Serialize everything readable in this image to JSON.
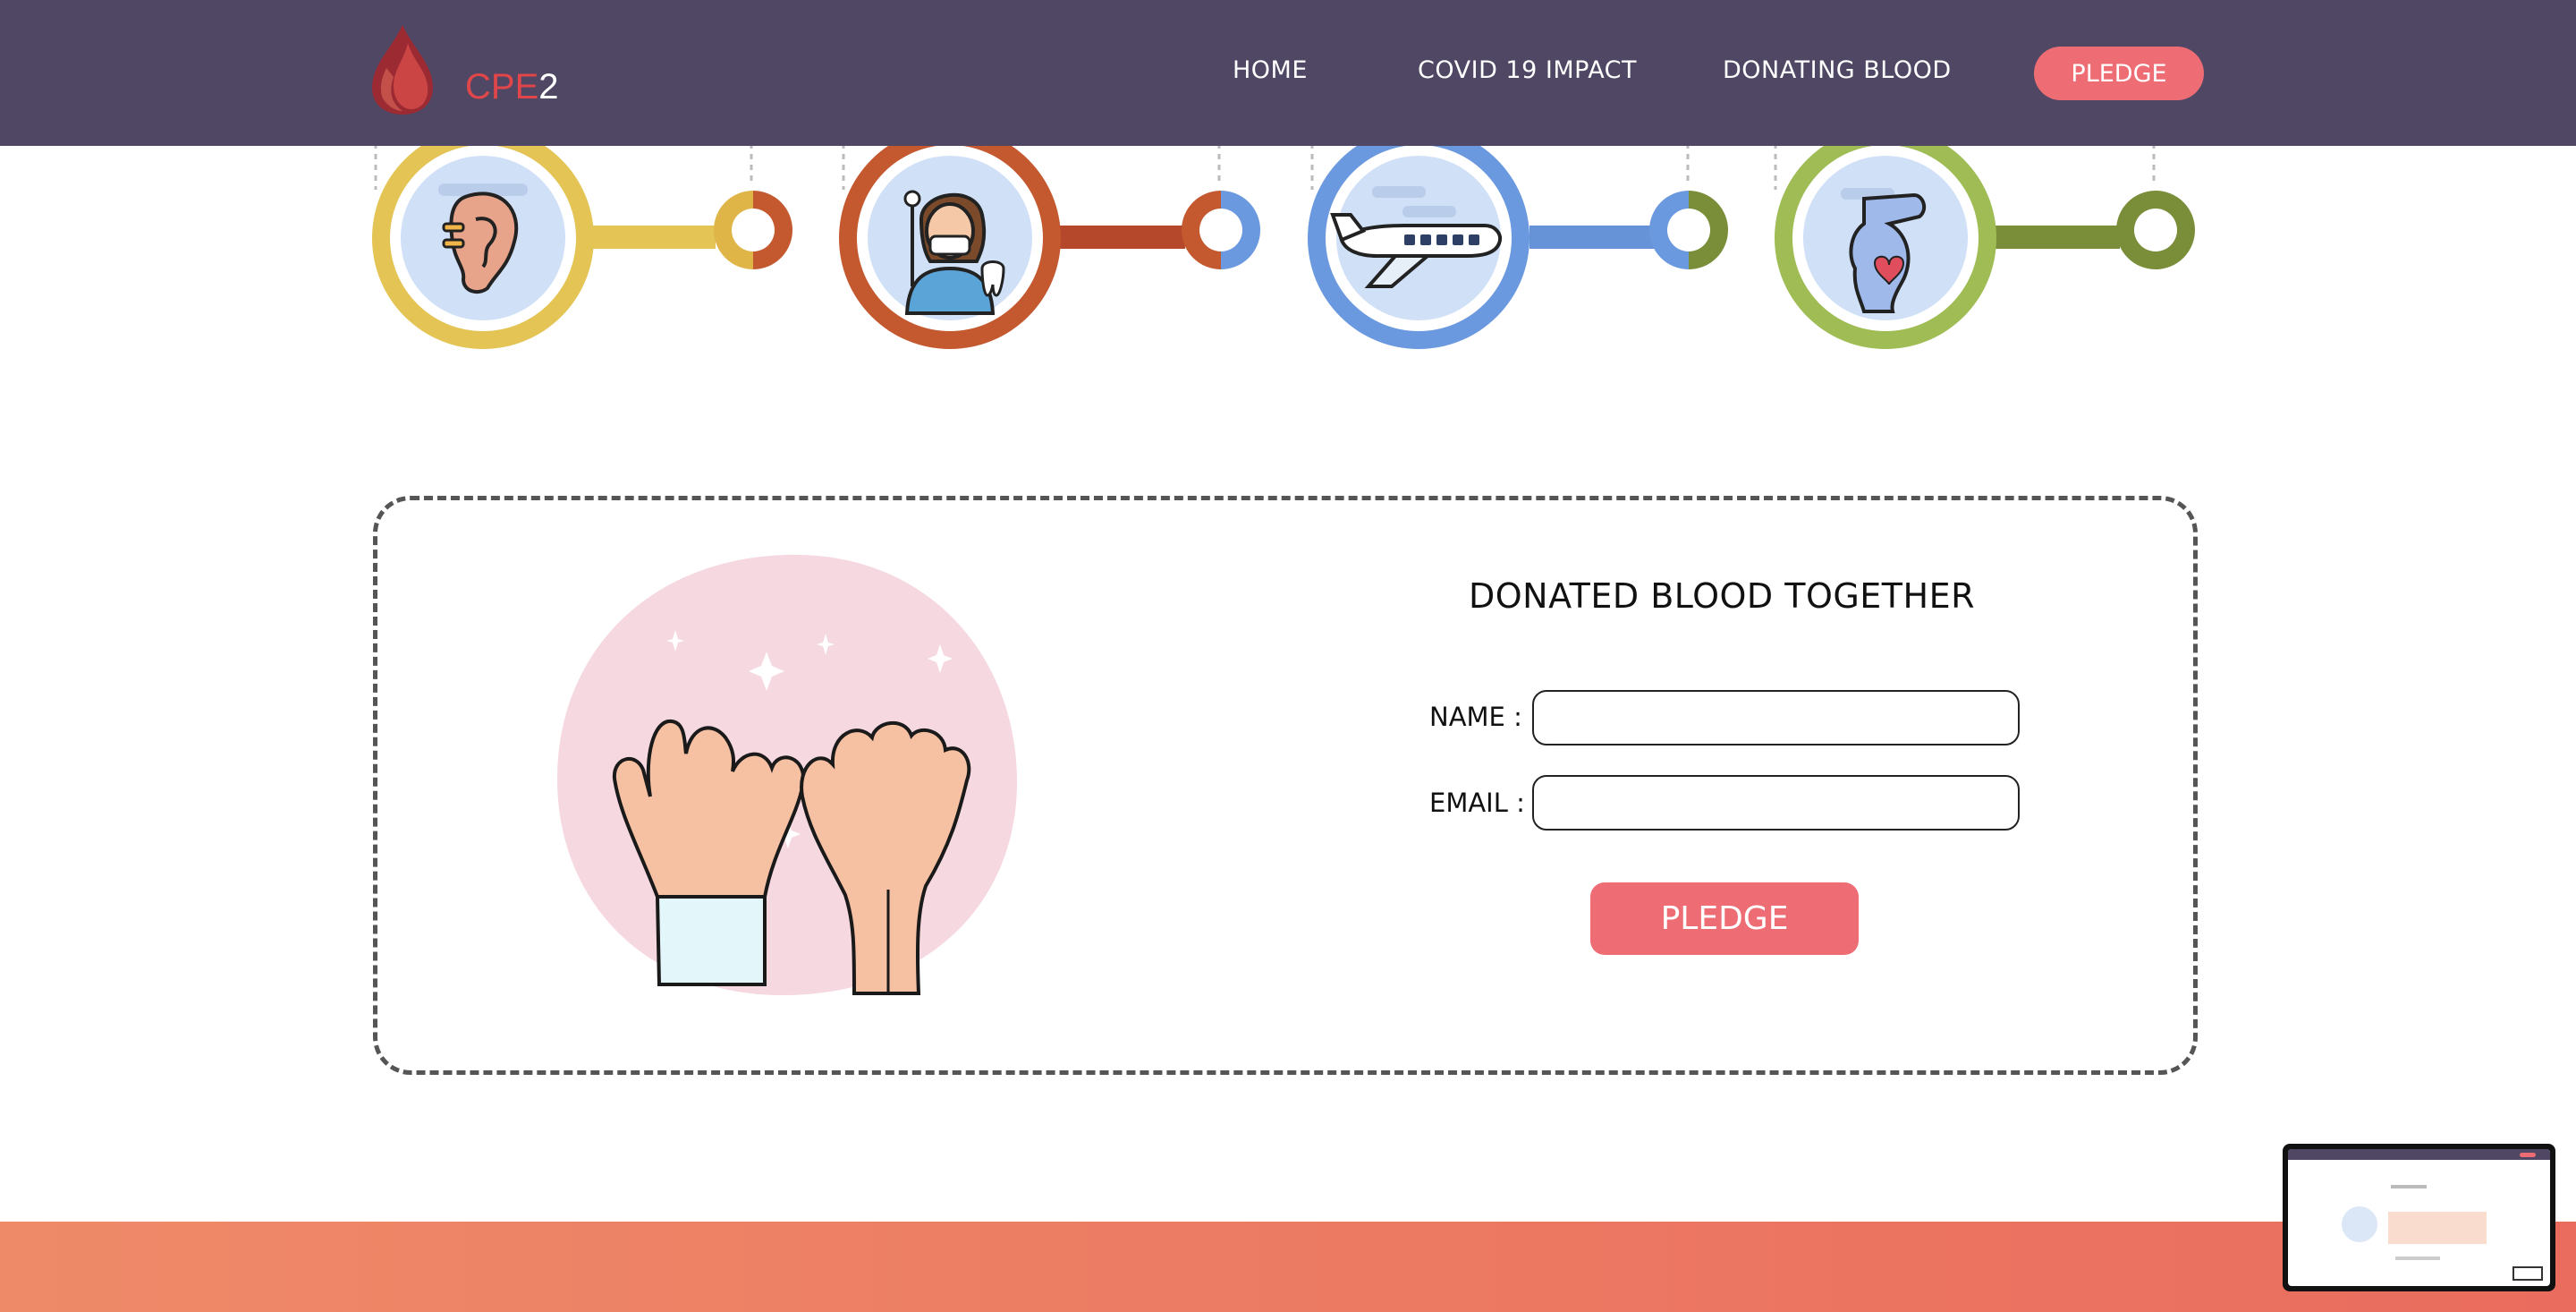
{
  "header": {
    "brand_part1": "CPE",
    "brand_part2": "2",
    "nav": {
      "home": "HOME",
      "covid": "COVID 19 IMPACT",
      "donating": "DONATING BLOOD",
      "pledge": "PLEDGE"
    }
  },
  "timeline": {
    "icons": [
      "ear-icon",
      "dentist-icon",
      "airplane-icon",
      "pregnancy-icon"
    ],
    "colors": [
      "#e3c454",
      "#c4582e",
      "#6b99df",
      "#9fbc55"
    ]
  },
  "pledge_form": {
    "title": "DONATED BLOOD TOGETHER",
    "name_label": "NAME :",
    "name_value": "",
    "email_label": "EMAIL :",
    "email_value": "",
    "submit_label": "PLEDGE"
  },
  "colors": {
    "header_bg": "#4f4763",
    "accent": "#ee6c74",
    "footer": "#ea7260"
  }
}
